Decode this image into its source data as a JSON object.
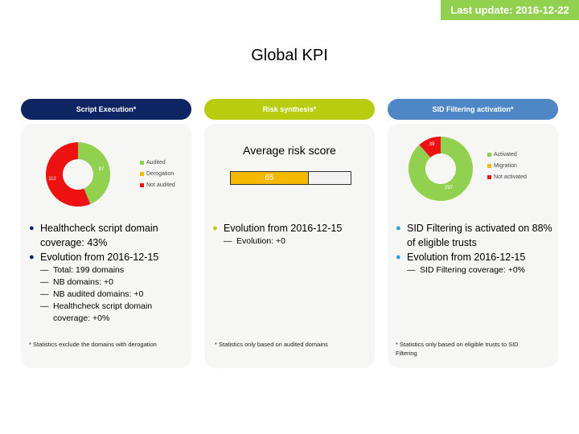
{
  "header": {
    "last_update": "Last update: 2016-12-22",
    "title": "Global KPI"
  },
  "colors": {
    "navy": "#0e2463",
    "lime": "#b9cc10",
    "blue": "#4f86c6",
    "green": "#92d050",
    "orange": "#f5b800",
    "red": "#ee1111"
  },
  "script_panel": {
    "header": "Script Execution*",
    "legend": [
      "Audited",
      "Derogation",
      "Not audited"
    ],
    "bullets": [
      {
        "text": "Healthcheck script domain coverage: 43%",
        "sub": []
      },
      {
        "text": "Evolution from 2016-12-15",
        "sub": [
          "Total: 199 domains",
          "NB domains: +0",
          "NB audited domains: +0",
          "Healthcheck script domain coverage: +0%"
        ]
      }
    ],
    "footnote": "* Statistics exclude the domains with derogation"
  },
  "risk_panel": {
    "header": "Risk synthesis*",
    "score_title": "Average risk score",
    "score_label": "65",
    "bullets": [
      {
        "text": "Evolution from 2016-12-15",
        "sub": [
          "Evolution: +0"
        ]
      }
    ],
    "footnote": "* Statistics only based on audited domains"
  },
  "sid_panel": {
    "header": "SID Filtering activation*",
    "legend": [
      "Activated",
      "Migration",
      "Not activated"
    ],
    "bullets": [
      {
        "text": "SID Filtering is activated on 88% of eligible trusts",
        "sub": []
      },
      {
        "text": "Evolution from 2016-12-15",
        "sub": [
          "SID Filtering coverage: +0%"
        ]
      }
    ],
    "footnote": "* Statistics only based on eligible trusts to SID Filtering"
  },
  "chart_data": [
    {
      "type": "pie",
      "labels": [
        "Audited",
        "Derogation",
        "Not audited"
      ],
      "values": [
        87,
        0,
        112
      ],
      "colors": [
        "#92d050",
        "#f5b800",
        "#ee1111"
      ]
    },
    {
      "type": "bar",
      "title": "Average risk score",
      "values": [
        65
      ],
      "ylim": [
        0,
        100
      ]
    },
    {
      "type": "pie",
      "labels": [
        "Activated",
        "Migration",
        "Not activated"
      ],
      "values": [
        297,
        0,
        39
      ],
      "colors": [
        "#92d050",
        "#f5b800",
        "#ee1111"
      ]
    }
  ]
}
